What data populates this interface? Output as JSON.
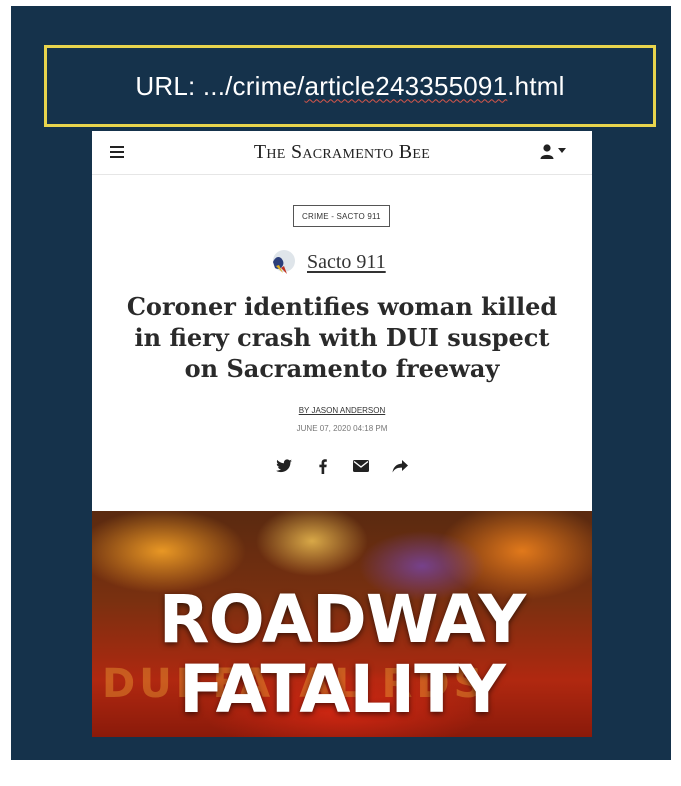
{
  "url_banner": {
    "prefix": "URL: .../crime/",
    "highlighted": "article243355091",
    "suffix": ".html"
  },
  "header": {
    "masthead": "The Sacramento Bee",
    "menu_icon": "hamburger-menu-icon",
    "account_icon": "user-icon"
  },
  "article": {
    "category": "CRIME - SACTO 911",
    "section_name": "Sacto 911",
    "headline_lines": [
      "Coroner identifies woman killed",
      "in fiery crash with DUI suspect",
      "on Sacramento freeway"
    ],
    "byline": "BY JASON ANDERSON",
    "dateline": "JUNE 07, 2020 04:18 PM",
    "share_icons": [
      "twitter-icon",
      "facebook-icon",
      "email-icon",
      "share-icon"
    ]
  },
  "hero_image": {
    "line1": "ROADWAY",
    "line2": "FATALITY",
    "background_text": "DUI   FATAL   RDS"
  },
  "colors": {
    "slide_background": "#15324b",
    "url_box_border": "#e8d44d"
  }
}
